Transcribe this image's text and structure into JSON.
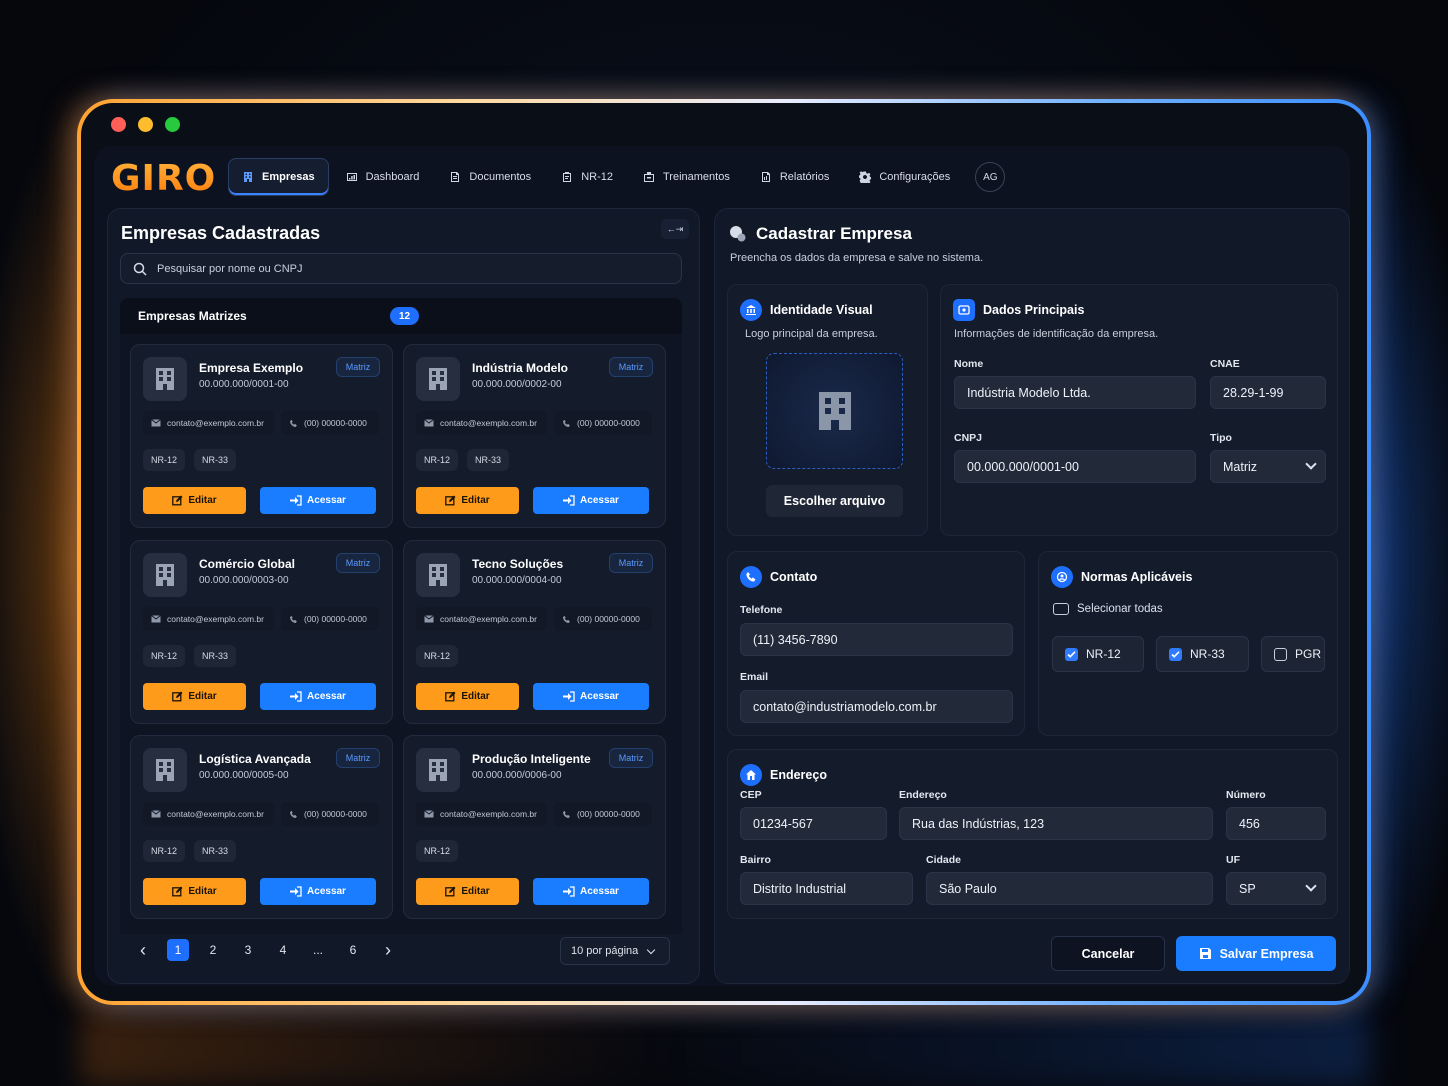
{
  "window": {
    "dots": [
      "#ff5f56",
      "#ffbd2e",
      "#27c93f"
    ]
  },
  "brand": {
    "logo": "GIRO"
  },
  "nav": {
    "tabs": [
      {
        "label": "Empresas",
        "icon": "building-icon",
        "active": true
      },
      {
        "label": "Dashboard",
        "icon": "chart-icon"
      },
      {
        "label": "Documentos",
        "icon": "document-icon"
      },
      {
        "label": "NR-12",
        "icon": "clipboard-icon"
      },
      {
        "label": "Treinamentos",
        "icon": "training-icon"
      },
      {
        "label": "Relatórios",
        "icon": "report-icon"
      },
      {
        "label": "Configurações",
        "icon": "gear-icon"
      }
    ],
    "avatar": "AG"
  },
  "list": {
    "title": "Empresas Cadastradas",
    "collapse": "←⇥",
    "search_placeholder": "Pesquisar por nome ou CNPJ",
    "section_title": "Empresas Matrizes",
    "section_count": "12",
    "cards": [
      {
        "name": "Empresa Exemplo",
        "cnpj": "00.000.000/0001-00",
        "badge": "Matriz",
        "email": "contato@exemplo.com.br",
        "phone": "(00) 00000-0000",
        "nrs": [
          "NR-12",
          "NR-33"
        ],
        "edit": "Editar",
        "access": "Acessar"
      },
      {
        "name": "Indústria Modelo",
        "cnpj": "00.000.000/0002-00",
        "badge": "Matriz",
        "email": "contato@exemplo.com.br",
        "phone": "(00) 00000-0000",
        "nrs": [
          "NR-12",
          "NR-33"
        ],
        "edit": "Editar",
        "access": "Acessar"
      },
      {
        "name": "Comércio Global",
        "cnpj": "00.000.000/0003-00",
        "badge": "Matriz",
        "email": "contato@exemplo.com.br",
        "phone": "(00) 00000-0000",
        "nrs": [
          "NR-12",
          "NR-33"
        ],
        "edit": "Editar",
        "access": "Acessar"
      },
      {
        "name": "Tecno Soluções",
        "cnpj": "00.000.000/0004-00",
        "badge": "Matriz",
        "email": "contato@exemplo.com.br",
        "phone": "(00) 00000-0000",
        "nrs": [
          "NR-12"
        ],
        "edit": "Editar",
        "access": "Acessar"
      },
      {
        "name": "Logística Avançada",
        "cnpj": "00.000.000/0005-00",
        "badge": "Matriz",
        "email": "contato@exemplo.com.br",
        "phone": "(00) 00000-0000",
        "nrs": [
          "NR-12",
          "NR-33"
        ],
        "edit": "Editar",
        "access": "Acessar"
      },
      {
        "name": "Produção Inteligente",
        "cnpj": "00.000.000/0006-00",
        "badge": "Matriz",
        "email": "contato@exemplo.com.br",
        "phone": "(00) 00000-0000",
        "nrs": [
          "NR-12"
        ],
        "edit": "Editar",
        "access": "Acessar"
      }
    ],
    "pagination": {
      "prev": "‹",
      "pages": [
        "1",
        "2",
        "3",
        "4",
        "...",
        "6"
      ],
      "current": "1",
      "next": "›",
      "per_page": "10 por página"
    }
  },
  "form": {
    "title": "Cadastrar Empresa",
    "subtitle": "Preencha os dados da empresa e salve no sistema.",
    "identity": {
      "title": "Identidade Visual",
      "subtitle": "Logo principal da empresa.",
      "choose_file": "Escolher arquivo"
    },
    "main": {
      "title": "Dados Principais",
      "subtitle": "Informações de identificação da empresa.",
      "nome_label": "Nome",
      "nome": "Indústria Modelo Ltda.",
      "cnae_label": "CNAE",
      "cnae": "28.29-1-99",
      "cnpj_label": "CNPJ",
      "cnpj": "00.000.000/0001-00",
      "tipo_label": "Tipo",
      "tipo": "Matriz"
    },
    "contact": {
      "title": "Contato",
      "phone_label": "Telefone",
      "phone": "(11) 3456-7890",
      "email_label": "Email",
      "email": "contato@industriamodelo.com.br"
    },
    "norms": {
      "title": "Normas Aplicáveis",
      "select_all": "Selecionar todas",
      "items": [
        {
          "label": "NR-12",
          "checked": true
        },
        {
          "label": "NR-33",
          "checked": true
        },
        {
          "label": "PGR",
          "checked": false
        }
      ]
    },
    "address": {
      "title": "Endereço",
      "cep_label": "CEP",
      "cep": "01234-567",
      "street_label": "Endereço",
      "street": "Rua das Indústrias, 123",
      "number_label": "Número",
      "number": "456",
      "district_label": "Bairro",
      "district": "Distrito Industrial",
      "city_label": "Cidade",
      "city": "São Paulo",
      "uf_label": "UF",
      "uf": "SP"
    },
    "cancel": "Cancelar",
    "save": "Salvar Empresa"
  },
  "colors": {
    "accent": "#1f6fff",
    "edit": "#ff9b1a",
    "logo": "#ff8c14"
  }
}
